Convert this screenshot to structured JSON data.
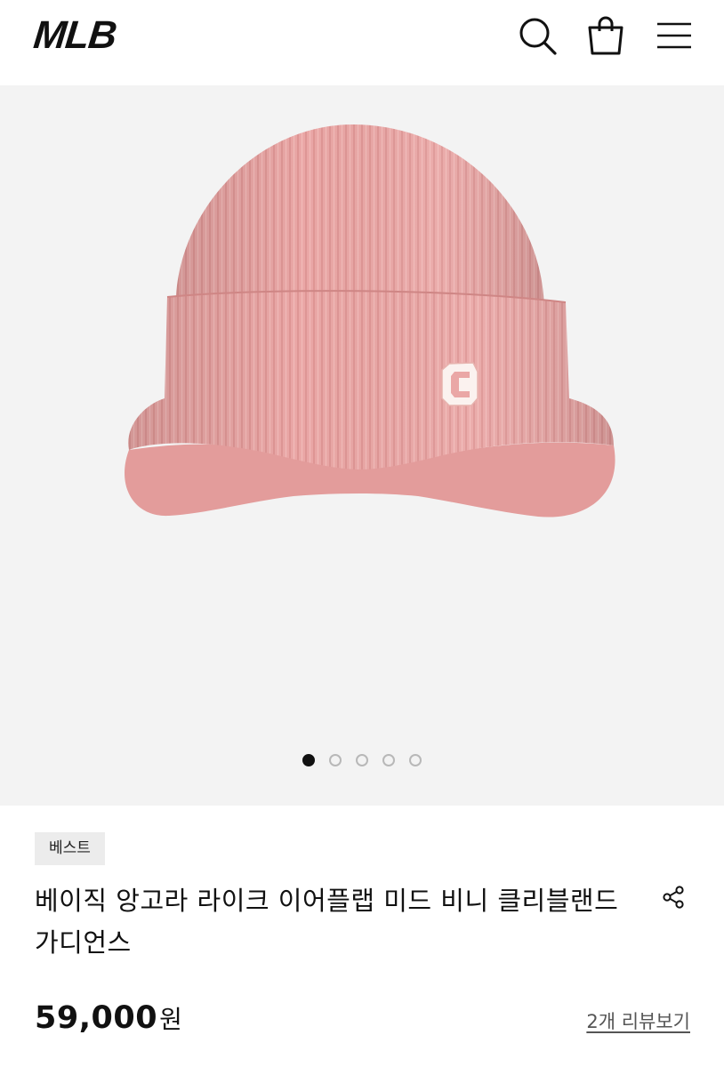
{
  "header": {
    "logo": "MLB",
    "icons": [
      "search-icon",
      "shopping-bag-icon",
      "menu-icon"
    ]
  },
  "gallery": {
    "image": "pink-beanie-product-photo",
    "slide_count": 5,
    "active_slide": 1
  },
  "product": {
    "badge": "베스트",
    "title": "베이직 앙고라 라이크 이어플랩 미드 비니 클리블랜드 가디언스",
    "price": "59,000",
    "currency": "원",
    "review_link": "2개 리뷰보기"
  },
  "colors": {
    "beanie_pink": "#eaa7a6",
    "hero_background": "#f3f3f3",
    "logo_patch": "#fbf2ef"
  }
}
